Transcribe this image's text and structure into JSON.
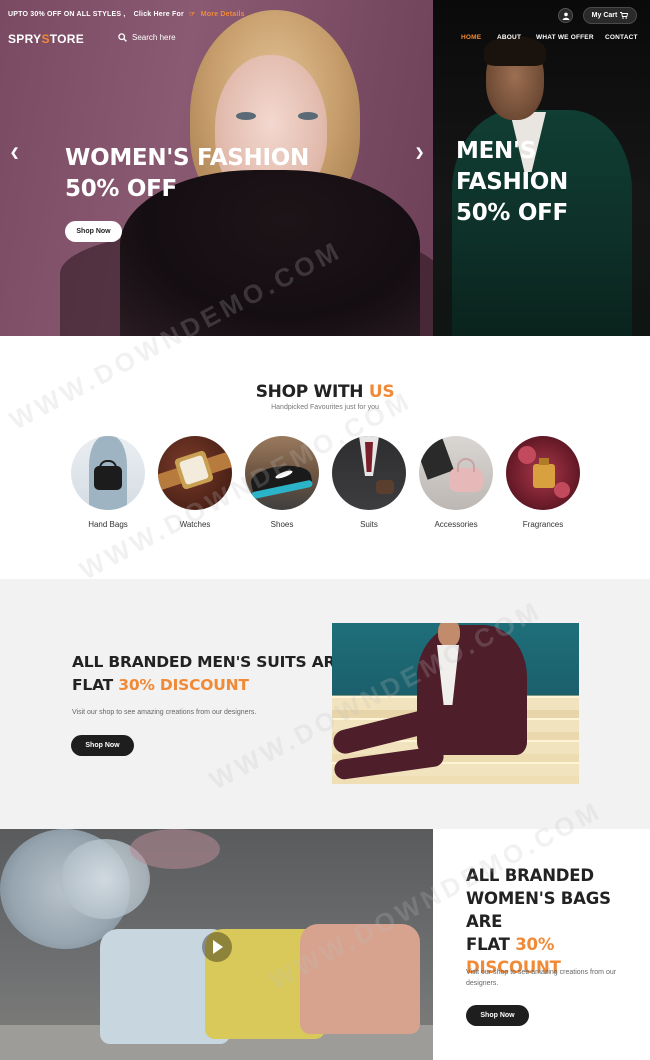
{
  "promo": {
    "text": "UPTO 30% OFF ON ALL STYLES ,",
    "click_text": "Click Here For",
    "link_text": "More Details"
  },
  "header": {
    "logo_main": "SPRY",
    "logo_accent": "S",
    "logo_tail": "TORE",
    "search_placeholder": "Search here",
    "cart_label": "My Cart",
    "nav": [
      {
        "label": "HOME",
        "active": true
      },
      {
        "label": "ABOUT",
        "active": false
      },
      {
        "label": "WHAT WE OFFER",
        "active": false
      },
      {
        "label": "CONTACT",
        "active": false
      }
    ]
  },
  "hero": {
    "left": {
      "line1": "WOMEN'S FASHION",
      "line2": "50% OFF",
      "button": "Shop Now"
    },
    "right": {
      "line1": "MEN'S FASHION",
      "line2": "50% OFF"
    }
  },
  "shop": {
    "title_main": "SHOP WITH",
    "title_accent": "US",
    "subtitle": "Handpicked Favourites just for you",
    "categories": [
      {
        "label": "Hand Bags",
        "icon": "handbag-photo"
      },
      {
        "label": "Watches",
        "icon": "watch-photo"
      },
      {
        "label": "Shoes",
        "icon": "shoe-photo"
      },
      {
        "label": "Suits",
        "icon": "suit-photo"
      },
      {
        "label": "Accessories",
        "icon": "accessories-photo"
      },
      {
        "label": "Fragrances",
        "icon": "fragrance-photo"
      }
    ]
  },
  "suits_banner": {
    "line1": "ALL BRANDED MEN'S SUITS ARE",
    "line2_main": "FLAT",
    "line2_accent": "30% DISCOUNT",
    "copy": "Visit our shop to see amazing creations from our designers.",
    "button": "Shop Now"
  },
  "bags_banner": {
    "line1": "ALL BRANDED",
    "line2": "WOMEN'S BAGS ARE",
    "line3_main": "FLAT",
    "line3_accent": "30%",
    "line4_accent": "DISCOUNT",
    "copy_line1": "Visit our shop to see amazing creations from our",
    "copy_line2": "designers.",
    "button": "Shop Now"
  },
  "watermark": "WWW.DOWNDEMO.COM",
  "colors": {
    "accent": "#f08a37",
    "dark": "#1e1e1e",
    "band": "#f2f2f2"
  }
}
